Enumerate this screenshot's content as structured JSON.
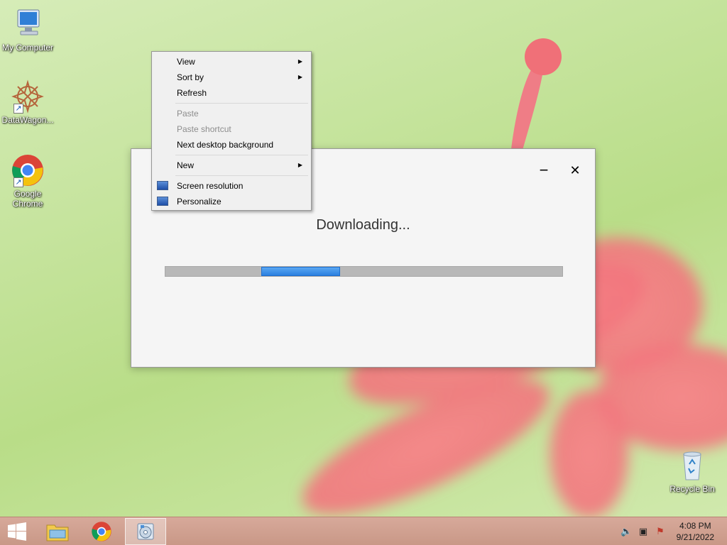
{
  "desktop": {
    "icons": [
      {
        "label": "My Computer"
      },
      {
        "label": "DataWagon..."
      },
      {
        "label": "Google Chrome"
      },
      {
        "label": "Recycle Bin"
      }
    ]
  },
  "context_menu": {
    "items": {
      "view": "View",
      "sort_by": "Sort by",
      "refresh": "Refresh",
      "paste": "Paste",
      "paste_shortcut": "Paste shortcut",
      "next_background": "Next desktop background",
      "new": "New",
      "screen_resolution": "Screen resolution",
      "personalize": "Personalize"
    },
    "submenu_arrow": "▶"
  },
  "download_window": {
    "status": "Downloading...",
    "minimize_glyph": "−",
    "close_glyph": "✕",
    "accent_color": "#2b80e0"
  },
  "taskbar": {
    "start_icon": "windows-logo-icon",
    "pinned": [
      "file-explorer-icon",
      "chrome-icon",
      "installer-icon"
    ],
    "tray": [
      "volume-muted-icon",
      "network-icon",
      "action-center-flag-icon"
    ],
    "clock": {
      "time": "4:08 PM",
      "date": "9/21/2022"
    }
  }
}
